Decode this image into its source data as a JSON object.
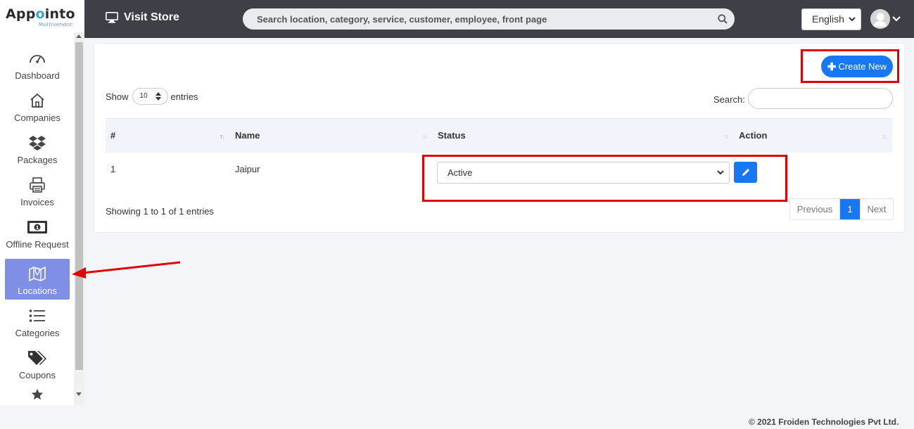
{
  "brand": {
    "name_part1": "App",
    "name_part2": "o",
    "name_part3": "into",
    "subtitle": "Multivendor"
  },
  "sidebar": {
    "items": [
      {
        "label": "Dashboard",
        "icon": "gauge-icon"
      },
      {
        "label": "Companies",
        "icon": "home-icon"
      },
      {
        "label": "Packages",
        "icon": "dropbox-icon"
      },
      {
        "label": "Invoices",
        "icon": "printer-icon"
      },
      {
        "label": "Offline Request",
        "icon": "money-bill-icon"
      },
      {
        "label": "Locations",
        "icon": "map-icon",
        "active": true
      },
      {
        "label": "Categories",
        "icon": "list-icon"
      },
      {
        "label": "Coupons",
        "icon": "tags-icon"
      },
      {
        "label": "",
        "icon": "star-icon"
      }
    ]
  },
  "topbar": {
    "visit_store": "Visit Store",
    "search_placeholder": "Search location, category, service, customer, employee, front page",
    "language": "English"
  },
  "card": {
    "create_button": "Create New",
    "show_label": "Show",
    "entries_value": "10",
    "entries_label": "entries",
    "search_label": "Search:",
    "columns": [
      "#",
      "Name",
      "Status",
      "Action"
    ],
    "rows": [
      {
        "index": "1",
        "name": "Jaipur",
        "status": "Active"
      }
    ],
    "showing": "Showing 1 to 1 of 1 entries",
    "pager": {
      "prev": "Previous",
      "current": "1",
      "next": "Next"
    }
  },
  "footer": "© 2021 Froiden Technologies Pvt Ltd.",
  "colors": {
    "accent": "#1877f2",
    "sidebar_active": "#7f8fe6",
    "topbar": "#3f4047",
    "annotation": "#e00000"
  }
}
